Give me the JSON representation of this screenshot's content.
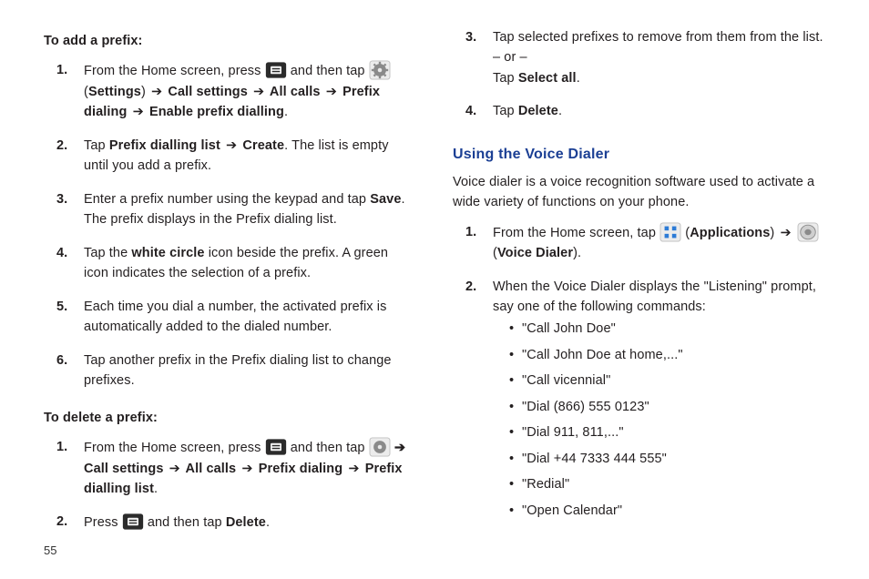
{
  "pageNumber": "55",
  "left": {
    "addPrefixHeading": "To add a prefix:",
    "steps": [
      {
        "pre": "From the Home screen, press ",
        "mid1": " and then tap ",
        "after": " (",
        "b1": "Settings",
        "t1": ") ",
        "arrow1": "➔",
        "b2": " Call settings ",
        "arrow2": "➔",
        "b3": " All calls  ",
        "arrow3": "➔",
        "b4": " Prefix dialing  ",
        "arrow4": "➔",
        "b5": " Enable prefix dialling",
        "tail": "."
      },
      {
        "t1": "Tap ",
        "b1": "Prefix dialling list ",
        "arrow1": "➔",
        "b2": " Create",
        "t2": ". The list is empty until you add a prefix."
      },
      {
        "t1": "Enter a prefix number using the keypad and tap ",
        "b1": "Save",
        "t2": ". The prefix displays in the Prefix dialing list."
      },
      {
        "t1": "Tap the ",
        "b1": "white circle",
        "t2": " icon beside the prefix. A green icon indicates the selection of a prefix."
      },
      {
        "t1": "Each time you dial a number, the activated prefix is automatically added to the dialed number."
      },
      {
        "t1": "Tap another prefix in the Prefix dialing list to change prefixes."
      }
    ],
    "delPrefixHeading": "To delete a prefix:",
    "delSteps": [
      {
        "pre": "From the Home screen, press ",
        "mid1": " and then tap ",
        "arrow1": " ➔ ",
        "b1": "Call settings ",
        "arrow2": "➔",
        "b2": " All calls ",
        "arrow3": "➔",
        "b3": " Prefix dialing ",
        "arrow4": "➔",
        "b4": " Prefix dialling list",
        "tail": "."
      },
      {
        "t1": "Press ",
        "t2": " and then tap ",
        "b1": "Delete",
        "t3": "."
      }
    ]
  },
  "right": {
    "stepsTop": [
      {
        "t1": "Tap selected prefixes to remove from them from the list.",
        "or": "– or –",
        "t2": "Tap ",
        "b1": "Select all",
        "t3": "."
      },
      {
        "t1": "Tap ",
        "b1": "Delete",
        "t2": "."
      }
    ],
    "sectionHeading": "Using the Voice Dialer",
    "intro": "Voice dialer is a voice recognition software used to activate a wide variety of functions on your phone.",
    "voiceSteps": [
      {
        "t1": "From the Home screen, tap ",
        "t2": "  (",
        "b1": "Applications",
        "t3": ") ",
        "arrow1": "➔",
        "t4": "  ",
        "t5": " (",
        "b2": "Voice Dialer",
        "t6": ")."
      },
      {
        "t1": "When the Voice Dialer displays the \"Listening\" prompt, say one of the following commands:"
      }
    ],
    "bullets": [
      "\"Call John Doe\"",
      "\"Call John Doe at home,...\"",
      "\"Call vicennial\"",
      "\"Dial (866) 555 0123\"",
      "\"Dial 911, 811,...\"",
      "\"Dial +44 7333 444 555\"",
      "\"Redial\"",
      "\"Open Calendar\""
    ]
  }
}
